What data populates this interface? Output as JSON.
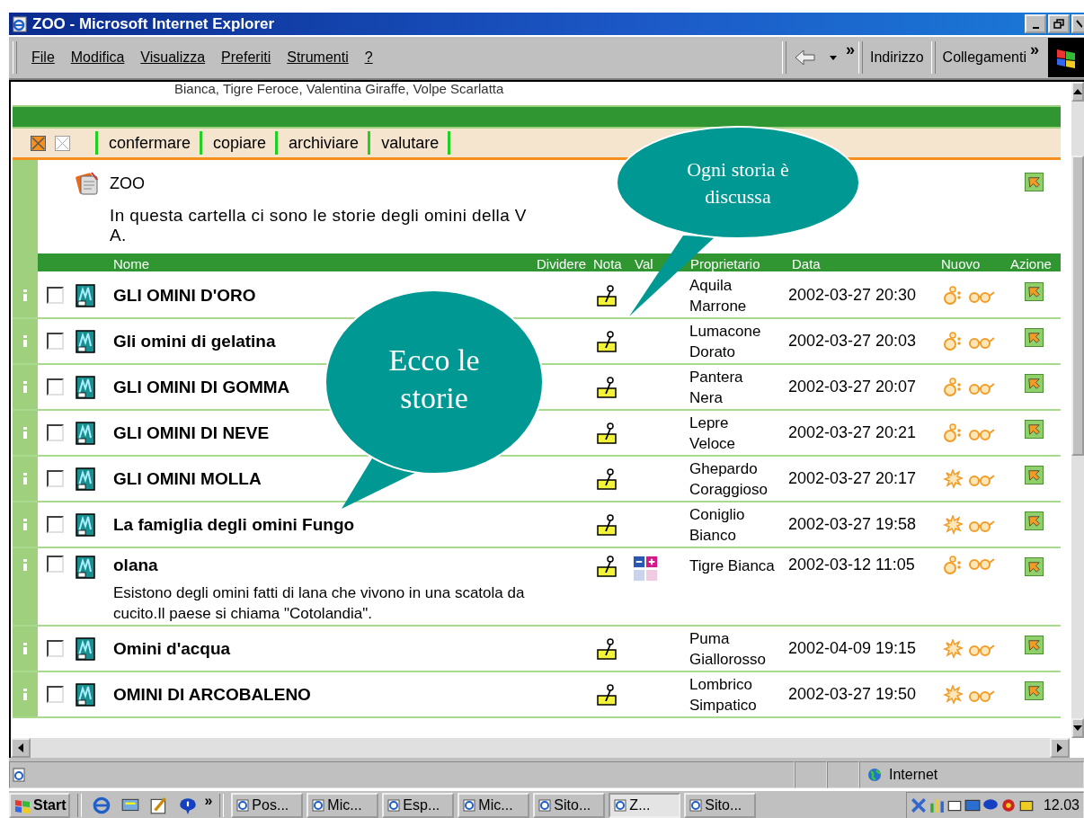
{
  "window": {
    "title": "ZOO - Microsoft Internet Explorer"
  },
  "menu": [
    "File",
    "Modifica",
    "Visualizza",
    "Preferiti",
    "Strumenti",
    "?"
  ],
  "toolbar": {
    "chevron": "»",
    "address_label": "Indirizzo",
    "links_label": "Collegamenti",
    "links_chevron": "»"
  },
  "page": {
    "top_line": "Bianca, Tigre Feroce, Valentina Giraffe, Volpe Scarlatta",
    "actions": [
      "confermare",
      "copiare",
      "archiviare",
      "valutare"
    ],
    "folder": {
      "title": "ZOO",
      "description": "In questa cartella ci sono le storie degli omini della V A."
    },
    "columns": [
      "Nome",
      "Dividere",
      "Nota",
      "Val",
      "Proprietario",
      "Data",
      "Nuovo",
      "Azione"
    ],
    "rows": [
      {
        "title": "GLI OMINI D'ORO",
        "checked": false,
        "rated": false,
        "owner": "Aquila Marrone",
        "date": "2002-03-27 20:30",
        "starred": false
      },
      {
        "title": "Gli omini di gelatina",
        "checked": false,
        "rated": false,
        "owner": "Lumacone Dorato",
        "date": "2002-03-27 20:03",
        "starred": false
      },
      {
        "title": "GLI OMINI DI GOMMA",
        "checked": false,
        "rated": false,
        "owner": "Pantera Nera",
        "date": "2002-03-27 20:07",
        "starred": false
      },
      {
        "title": "GLI OMINI DI NEVE",
        "checked": false,
        "rated": false,
        "owner": "Lepre Veloce",
        "date": "2002-03-27 20:21",
        "starred": false
      },
      {
        "title": "GLI OMINI MOLLA",
        "checked": false,
        "rated": false,
        "owner": "Ghepardo Coraggioso",
        "date": "2002-03-27 20:17",
        "starred": true
      },
      {
        "title": "La famiglia degli omini Fungo",
        "checked": false,
        "rated": false,
        "owner": "Coniglio Bianco",
        "date": "2002-03-27 19:58",
        "starred": true
      },
      {
        "title": "olana",
        "checked": false,
        "rated": true,
        "owner": "Tigre Bianca",
        "date": "2002-03-12 11:05",
        "starred": false,
        "description": "Esistono degli omini fatti di lana che vivono in una scatola da cucito.Il paese si chiama \"Cotolandia\"."
      },
      {
        "title": "Omini d'acqua",
        "checked": false,
        "rated": false,
        "owner": "Puma Giallorosso",
        "date": "2002-04-09 19:15",
        "starred": true
      },
      {
        "title": "OMINI DI ARCOBALENO",
        "checked": false,
        "rated": false,
        "owner": "Lombrico Simpatico",
        "date": "2002-03-27 19:50",
        "starred": true
      }
    ]
  },
  "callouts": [
    {
      "text": "Ogni storia è discussa"
    },
    {
      "text": "Ecco le storie"
    }
  ],
  "status_bar": {
    "zone": "Internet"
  },
  "taskbar": {
    "start": "Start",
    "chevron": "»",
    "tasks": [
      {
        "label": "Pos...",
        "selected": false
      },
      {
        "label": "Mic...",
        "selected": false
      },
      {
        "label": "Esp...",
        "selected": false
      },
      {
        "label": "Mic...",
        "selected": false
      },
      {
        "label": "Sito...",
        "selected": false
      },
      {
        "label": "Z...",
        "selected": true
      },
      {
        "label": "Sito...",
        "selected": false
      }
    ],
    "clock": "12.03"
  }
}
